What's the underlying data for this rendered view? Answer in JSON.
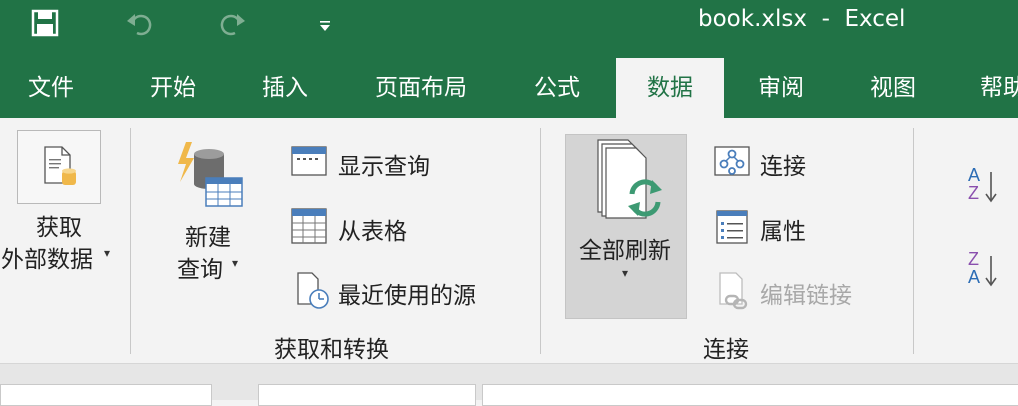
{
  "app": {
    "title": "book.xlsx  -  Excel",
    "theme_color": "#217346"
  },
  "quick_access": {
    "icons": [
      "save-icon",
      "undo-icon",
      "redo-icon",
      "customize-dropdown-icon"
    ]
  },
  "tabs": [
    {
      "label": "文件",
      "active": false
    },
    {
      "label": "开始",
      "active": false
    },
    {
      "label": "插入",
      "active": false
    },
    {
      "label": "页面布局",
      "active": false
    },
    {
      "label": "公式",
      "active": false
    },
    {
      "label": "数据",
      "active": true
    },
    {
      "label": "审阅",
      "active": false
    },
    {
      "label": "视图",
      "active": false
    },
    {
      "label": "帮助",
      "active": false
    }
  ],
  "ribbon": {
    "get_external": {
      "line1": "获取",
      "line2": "外部数据"
    },
    "get_transform": {
      "new_query": {
        "line1": "新建",
        "line2": "查询"
      },
      "show_queries": "显示查询",
      "from_table": "从表格",
      "recent_sources": "最近使用的源",
      "group_label": "获取和转换"
    },
    "connections": {
      "refresh_all": "全部刷新",
      "connections": "连接",
      "properties": "属性",
      "edit_links": "编辑链接",
      "group_label": "连接"
    },
    "sort": {
      "az_top": "A",
      "az_bottom": "Z",
      "za_top": "Z",
      "za_bottom": "A"
    }
  }
}
